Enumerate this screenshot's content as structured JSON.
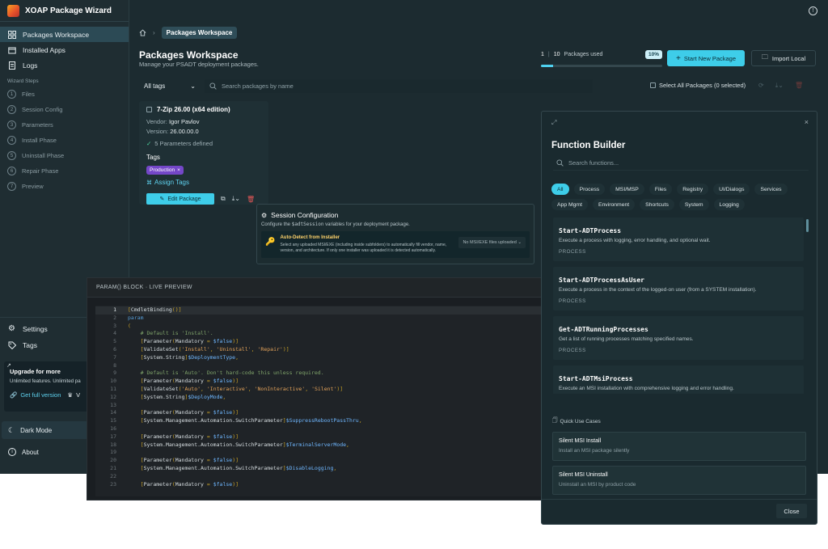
{
  "app": {
    "title": "XOAP Package Wizard"
  },
  "nav": [
    {
      "label": "Packages Workspace",
      "icon": "grid-icon",
      "active": true
    },
    {
      "label": "Installed Apps",
      "icon": "box-icon"
    },
    {
      "label": "Logs",
      "icon": "log-icon"
    }
  ],
  "wizard": {
    "label": "Wizard Steps",
    "steps": [
      {
        "num": "1",
        "label": "Files"
      },
      {
        "num": "2",
        "label": "Session Config"
      },
      {
        "num": "3",
        "label": "Parameters"
      },
      {
        "num": "4",
        "label": "Install Phase"
      },
      {
        "num": "5",
        "label": "Uninstall Phase"
      },
      {
        "num": "6",
        "label": "Repair Phase"
      },
      {
        "num": "7",
        "label": "Preview"
      }
    ]
  },
  "sidebar_bottom": {
    "settings": "Settings",
    "tags": "Tags",
    "upgrade_title": "Upgrade for more",
    "upgrade_sub": "Unlimited features. Unlimited pa",
    "upgrade_link": "Get full version",
    "upgrade_link2": "V",
    "dark_mode": "Dark Mode",
    "about": "About"
  },
  "breadcrumb": {
    "current": "Packages Workspace"
  },
  "header": {
    "title": "Packages Workspace",
    "subtitle": "Manage your PSADT deployment packages."
  },
  "usage": {
    "used": "1",
    "total": "10",
    "label": "Packages used",
    "percent_label": "10%",
    "fraction": 0.1
  },
  "actions": {
    "new_package": "Start New Package",
    "import": "Import Local"
  },
  "toolbar": {
    "filter": "All tags",
    "search_placeholder": "Search packages by name",
    "select_all": "Select All Packages (0 selected)"
  },
  "package": {
    "name": "7-Zip 26.00 (x64 edition)",
    "vendor_label": "Vendor:",
    "vendor": "Igor Pavlov",
    "version_label": "Version:",
    "version": "26.00.00.0",
    "params": "5 Parameters defined",
    "tags_label": "Tags",
    "tag": "Production",
    "assign": "Assign Tags",
    "edit": "Edit Package"
  },
  "session": {
    "title": "Session Configuration",
    "sub_prefix": "Configure the ",
    "sub_code": "$adtSession",
    "sub_suffix": " variables for your deployment package.",
    "auto_title": "Auto-Detect from Installer",
    "auto_desc": "Select any uploaded MSI/EXE (including inside subfolders) to automatically fill vendor, name, version, and architecture. If only one installer was uploaded it is detected automatically.",
    "auto_select": "No MSI/EXE files uploaded"
  },
  "editor": {
    "title": "PARAM() BLOCK · LIVE PREVIEW",
    "lines": [
      {
        "n": "1",
        "code": "[CmdletBinding()]"
      },
      {
        "n": "2",
        "code": "param"
      },
      {
        "n": "3",
        "code": "("
      },
      {
        "n": "4",
        "code": "    # Default is 'Install'."
      },
      {
        "n": "5",
        "code": "    [Parameter(Mandatory = $false)]"
      },
      {
        "n": "6",
        "code": "    [ValidateSet('Install', 'Uninstall', 'Repair')]"
      },
      {
        "n": "7",
        "code": "    [System.String]$DeploymentType,"
      },
      {
        "n": "8",
        "code": ""
      },
      {
        "n": "9",
        "code": "    # Default is 'Auto'. Don't hard-code this unless required."
      },
      {
        "n": "10",
        "code": "    [Parameter(Mandatory = $false)]"
      },
      {
        "n": "11",
        "code": "    [ValidateSet('Auto', 'Interactive', 'NonInteractive', 'Silent')]"
      },
      {
        "n": "12",
        "code": "    [System.String]$DeployMode,"
      },
      {
        "n": "13",
        "code": ""
      },
      {
        "n": "14",
        "code": "    [Parameter(Mandatory = $false)]"
      },
      {
        "n": "15",
        "code": "    [System.Management.Automation.SwitchParameter]$SuppressRebootPassThru,"
      },
      {
        "n": "16",
        "code": ""
      },
      {
        "n": "17",
        "code": "    [Parameter(Mandatory = $false)]"
      },
      {
        "n": "18",
        "code": "    [System.Management.Automation.SwitchParameter]$TerminalServerMode,"
      },
      {
        "n": "19",
        "code": ""
      },
      {
        "n": "20",
        "code": "    [Parameter(Mandatory = $false)]"
      },
      {
        "n": "21",
        "code": "    [System.Management.Automation.SwitchParameter]$DisableLogging,"
      },
      {
        "n": "22",
        "code": ""
      },
      {
        "n": "23",
        "code": "    [Parameter(Mandatory = $false)]"
      }
    ]
  },
  "fb": {
    "title": "Function Builder",
    "search_placeholder": "Search functions...",
    "chips": [
      "All",
      "Process",
      "MSI/MSP",
      "Files",
      "Registry",
      "UI/Dialogs",
      "Services",
      "App Mgmt",
      "Environment",
      "Shortcuts",
      "System",
      "Logging"
    ],
    "functions": [
      {
        "name": "Start-ADTProcess",
        "desc": "Execute a process with logging, error handling, and optional wait.",
        "cat": "PROCESS"
      },
      {
        "name": "Start-ADTProcessAsUser",
        "desc": "Execute a process in the context of the logged-on user (from a SYSTEM installation).",
        "cat": "PROCESS"
      },
      {
        "name": "Get-ADTRunningProcesses",
        "desc": "Get a list of running processes matching specified names.",
        "cat": "PROCESS"
      },
      {
        "name": "Start-ADTMsiProcess",
        "desc": "Execute an MSI installation with comprehensive logging and error handling.",
        "cat": ""
      }
    ],
    "quick_label": "Quick Use Cases",
    "quick": [
      {
        "title": "Silent MSI Install",
        "sub": "Install an MSI package silently"
      },
      {
        "title": "Silent MSI Uninstall",
        "sub": "Uninstall an MSI by product code"
      }
    ],
    "close": "Close"
  },
  "colors": {
    "accent": "#3ecde9",
    "tag": "#7447c8",
    "danger": "#e45757"
  }
}
